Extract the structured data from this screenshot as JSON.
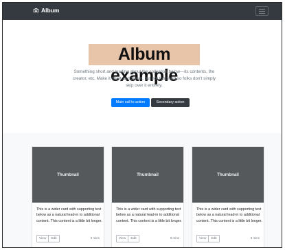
{
  "navbar": {
    "brand": "Album",
    "brand_icon": "camera-icon",
    "toggler_icon": "hamburger-icon"
  },
  "hero": {
    "title": "Album example",
    "lead": "Something short and leading about the collection below—its contents, the creator, etc. Make it short and sweet, but not too short so folks don't simply skip over it entirely.",
    "primary_button": "Main call to action",
    "secondary_button": "Secondary action"
  },
  "cards": [
    {
      "thumbnail": "Thumbnail",
      "text": "This is a wider card with supporting text below as a natural lead-in to additional content. This content is a little bit longer.",
      "view": "View",
      "edit": "Edit",
      "time": "9 mins"
    },
    {
      "thumbnail": "Thumbnail",
      "text": "This is a wider card with supporting text below as a natural lead-in to additional content. This content is a little bit longer.",
      "view": "View",
      "edit": "Edit",
      "time": "9 mins"
    },
    {
      "thumbnail": "Thumbnail",
      "text": "This is a wider card with supporting text below as a natural lead-in to additional content. This content is a little bit longer.",
      "view": "View",
      "edit": "Edit",
      "time": "9 mins"
    }
  ],
  "colors": {
    "navbar": "#343a40",
    "primary": "#007bff",
    "secondary": "#343a40",
    "thumbnail": "#55595c",
    "title_highlight": "#e8c4a8",
    "album_bg": "#f8f9fa"
  }
}
